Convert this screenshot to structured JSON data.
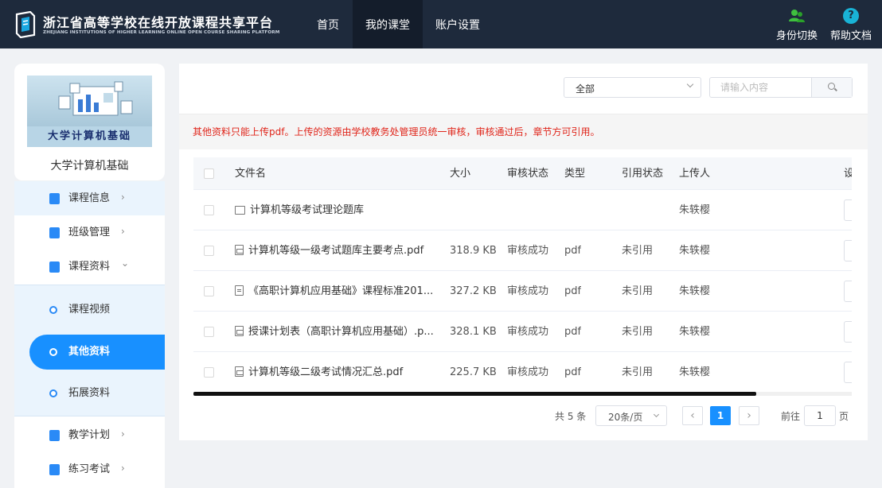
{
  "header": {
    "title": "浙江省高等学校在线开放课程共享平台",
    "subtitle": "ZHEJIANG INSTITUTIONS OF HIGHER LEARNING ONLINE OPEN COURSE SHARING PLATFORM",
    "nav": [
      {
        "label": "首页",
        "active": false
      },
      {
        "label": "我的课堂",
        "active": true
      },
      {
        "label": "账户设置",
        "active": false
      }
    ],
    "tools": {
      "switch_role": "身份切换",
      "help": "帮助文档",
      "help_glyph": "?"
    }
  },
  "sidebar": {
    "course_image_caption": "大学计算机基础",
    "course_name": "大学计算机基础",
    "menu": [
      {
        "label": "课程信息",
        "icon": "doc-icon",
        "arrow": "›"
      },
      {
        "label": "班级管理",
        "icon": "class-icon",
        "arrow": "›"
      },
      {
        "label": "课程资料",
        "icon": "book-icon",
        "arrow": "⌄"
      },
      {
        "label": "教学计划",
        "icon": "calendar-icon",
        "arrow": "›"
      },
      {
        "label": "练习考试",
        "icon": "exam-icon",
        "arrow": "›"
      }
    ],
    "submenu": [
      {
        "label": "课程视频",
        "active": false
      },
      {
        "label": "其他资料",
        "active": true
      },
      {
        "label": "拓展资料",
        "active": false
      }
    ]
  },
  "toolbar": {
    "filter_value": "全部",
    "search_placeholder": "请输入内容"
  },
  "notice": "其他资料只能上传pdf。上传的资源由学校教务处管理员统一审核，审核通过后，章节方可引用。",
  "table": {
    "columns": [
      "文件名",
      "大小",
      "审核状态",
      "类型",
      "引用状态",
      "上传人",
      "设"
    ],
    "rows": [
      {
        "icon": "folder-icon",
        "name": "计算机等级考试理论题库",
        "size": "",
        "review": "",
        "type": "",
        "cite": "",
        "uploader": "朱轶樱"
      },
      {
        "icon": "pdf-icon",
        "name": "计算机等级一级考试题库主要考点.pdf",
        "size": "318.9 KB",
        "review": "审核成功",
        "type": "pdf",
        "cite": "未引用",
        "uploader": "朱轶樱"
      },
      {
        "icon": "doc-icon",
        "name": "《高职计算机应用基础》课程标准201...",
        "size": "327.2 KB",
        "review": "审核成功",
        "type": "pdf",
        "cite": "未引用",
        "uploader": "朱轶樱"
      },
      {
        "icon": "pdf-icon",
        "name": "授课计划表（高职计算机应用基础）.p...",
        "size": "328.1 KB",
        "review": "审核成功",
        "type": "pdf",
        "cite": "未引用",
        "uploader": "朱轶樱"
      },
      {
        "icon": "pdf-icon",
        "name": "计算机等级二级考试情况汇总.pdf",
        "size": "225.7 KB",
        "review": "审核成功",
        "type": "pdf",
        "cite": "未引用",
        "uploader": "朱轶樱"
      }
    ]
  },
  "pagination": {
    "total": "共 5 条",
    "page_size": "20条/页",
    "prev": "‹",
    "current": "1",
    "next": "›",
    "goto_label": "前往",
    "goto_value": "1",
    "page_suffix": "页"
  },
  "colors": {
    "topbar": "#1e2a3c",
    "accent": "#1890ff",
    "notice_text": "#e0261b"
  }
}
